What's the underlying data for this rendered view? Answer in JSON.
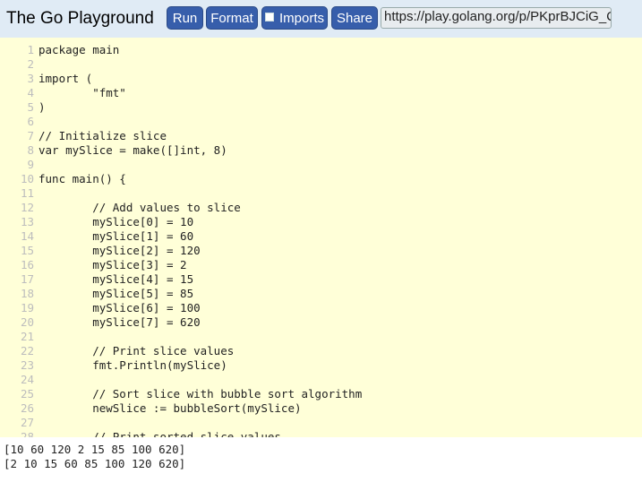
{
  "header": {
    "title": "The Go Playground",
    "run_label": "Run",
    "format_label": "Format",
    "imports_label": "Imports",
    "share_label": "Share",
    "url_value": "https://play.golang.org/p/PKprBJCiG_Q",
    "button_color": "#375eab",
    "bar_color": "#e0ebf5"
  },
  "editor": {
    "background": "#ffffd8",
    "lines": [
      {
        "num": "1",
        "text": "package main"
      },
      {
        "num": "2",
        "text": ""
      },
      {
        "num": "3",
        "text": "import ("
      },
      {
        "num": "4",
        "text": "        \"fmt\""
      },
      {
        "num": "5",
        "text": ")"
      },
      {
        "num": "6",
        "text": ""
      },
      {
        "num": "7",
        "text": "// Initialize slice"
      },
      {
        "num": "8",
        "text": "var mySlice = make([]int, 8)"
      },
      {
        "num": "9",
        "text": ""
      },
      {
        "num": "10",
        "text": "func main() {"
      },
      {
        "num": "11",
        "text": ""
      },
      {
        "num": "12",
        "text": "        // Add values to slice"
      },
      {
        "num": "13",
        "text": "        mySlice[0] = 10"
      },
      {
        "num": "14",
        "text": "        mySlice[1] = 60"
      },
      {
        "num": "15",
        "text": "        mySlice[2] = 120"
      },
      {
        "num": "16",
        "text": "        mySlice[3] = 2"
      },
      {
        "num": "17",
        "text": "        mySlice[4] = 15"
      },
      {
        "num": "18",
        "text": "        mySlice[5] = 85"
      },
      {
        "num": "19",
        "text": "        mySlice[6] = 100"
      },
      {
        "num": "20",
        "text": "        mySlice[7] = 620"
      },
      {
        "num": "21",
        "text": ""
      },
      {
        "num": "22",
        "text": "        // Print slice values"
      },
      {
        "num": "23",
        "text": "        fmt.Println(mySlice)"
      },
      {
        "num": "24",
        "text": ""
      },
      {
        "num": "25",
        "text": "        // Sort slice with bubble sort algorithm"
      },
      {
        "num": "26",
        "text": "        newSlice := bubbleSort(mySlice)"
      },
      {
        "num": "27",
        "text": ""
      },
      {
        "num": "28",
        "text": "        // Print sorted slice values"
      }
    ]
  },
  "output": {
    "lines": [
      "[10 60 120 2 15 85 100 620]",
      "[2 10 15 60 85 100 120 620]"
    ]
  }
}
